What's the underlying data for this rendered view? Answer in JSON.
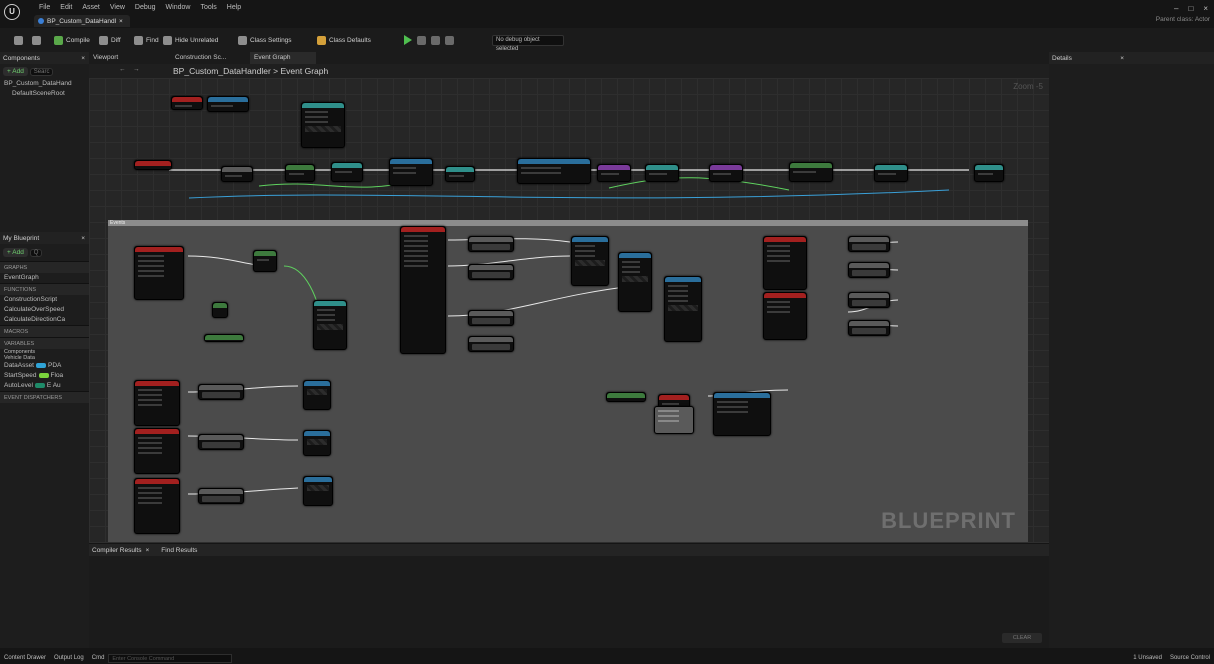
{
  "menu": [
    "File",
    "Edit",
    "Asset",
    "View",
    "Debug",
    "Window",
    "Tools",
    "Help"
  ],
  "doc_tab": "BP_Custom_DataHandl",
  "doc_tab_close": "×",
  "window_controls": [
    "–",
    "□",
    "×"
  ],
  "parent_class": "Parent class: Actor",
  "toolbar": {
    "compile": "Compile",
    "diff": "Diff",
    "find": "Find",
    "hide_unrelated": "Hide Unrelated",
    "class_settings": "Class Settings",
    "class_defaults": "Class Defaults",
    "debug_object": "No debug object selected"
  },
  "components": {
    "tab": "Components",
    "viewport_tab": "Viewport",
    "add": "+ Add",
    "search_placeholder": "Searc",
    "root": "BP_Custom_DataHand",
    "child": "DefaultSceneRoot"
  },
  "editor_tabs": {
    "construction": "Construction Sc...",
    "event_graph": "Event Graph",
    "breadcrumb": "BP_Custom_DataHandler > Event Graph",
    "zoom": "Zoom -5"
  },
  "my_blueprint": {
    "tab": "My Blueprint",
    "add": "+ Add",
    "sections": {
      "graphs": "GRAPHS",
      "functions": "FUNCTIONS",
      "macros": "MACROS",
      "variables": "VARIABLES",
      "event_dispatchers": "EVENT DISPATCHERS"
    },
    "graphs": [
      "EventGraph"
    ],
    "functions": [
      "ConstructionScript",
      "CalculateOverSpeed",
      "CalculateDirectionCa"
    ],
    "variable_groups": [
      "Components",
      "Vehicle Data"
    ],
    "variables": [
      {
        "name": "DataAsset",
        "type": "PDA",
        "color": "#2fa3d6"
      },
      {
        "name": "StartSpeed",
        "type": "Floa",
        "color": "#7ad23c"
      },
      {
        "name": "AutoLevel",
        "type": "E Au",
        "color": "#1e8a68"
      }
    ]
  },
  "details": {
    "tab": "Details"
  },
  "graph": {
    "comment_title": "Events",
    "watermark": "BLUEPRINT"
  },
  "bottom": {
    "compiler_results": "Compiler Results",
    "find_results": "Find Results",
    "clear": "CLEAR"
  },
  "status": {
    "content_drawer": "Content Drawer",
    "output_log": "Output Log",
    "cmd": "Cmd",
    "console_placeholder": "Enter Console Command",
    "unsaved": "1 Unsaved",
    "source_control": "Source Control"
  }
}
